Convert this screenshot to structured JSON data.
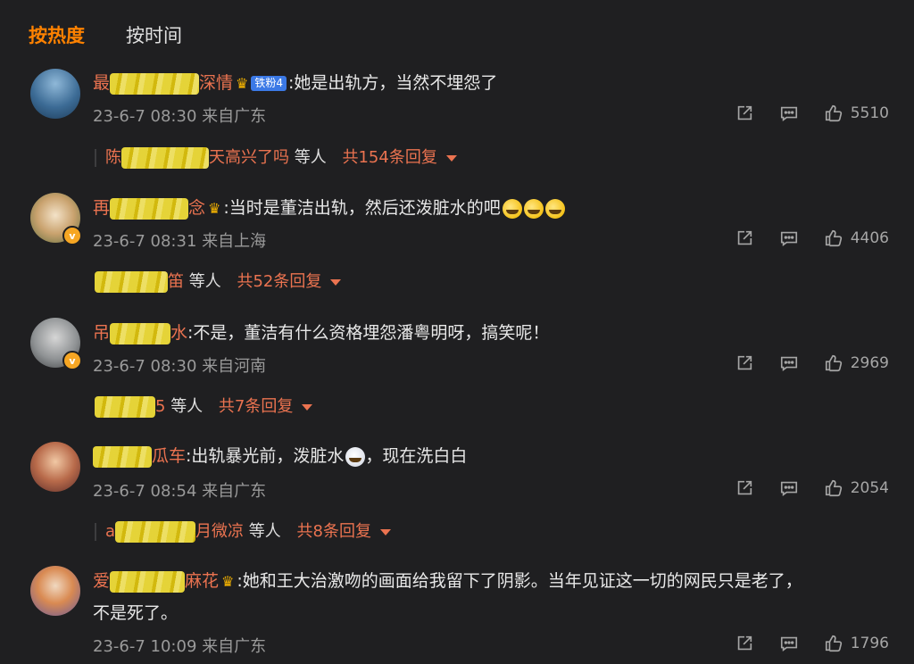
{
  "tabs": [
    "按热度",
    "按时间"
  ],
  "comments": [
    {
      "name_prefix": "最",
      "name_suffix": "深情",
      "fan_badge": "铁粉4",
      "text": ":她是出轨方，当然不埋怨了",
      "meta": "23-6-7 08:30 来自广东",
      "likes": "5510",
      "reply_prefix": "陈",
      "reply_suffix": "天高兴了吗",
      "reply_people": "等人",
      "reply_count": "共154条回复"
    },
    {
      "name_prefix": "再",
      "name_suffix": "念",
      "text": ":当时是董洁出轨，然后还泼脏水的吧",
      "meta": "23-6-7 08:31 来自上海",
      "likes": "4406",
      "reply_prefix": "",
      "reply_suffix": "笛",
      "reply_people": "等人",
      "reply_count": "共52条回复"
    },
    {
      "name_prefix": "吊",
      "name_suffix": "水",
      "text": ":不是，董洁有什么资格埋怨潘粤明呀，搞笑呢！",
      "meta": "23-6-7 08:30 来自河南",
      "likes": "2969",
      "reply_prefix": "",
      "reply_suffix": "5",
      "reply_people": "等人",
      "reply_count": "共7条回复"
    },
    {
      "name_prefix": "",
      "name_suffix": "瓜车",
      "text_a": ":出轨暴光前，泼脏水",
      "text_b": "，现在洗白白",
      "meta": "23-6-7 08:54 来自广东",
      "likes": "2054",
      "reply_prefix": "a",
      "reply_suffix": "月微凉",
      "reply_people": "等人",
      "reply_count": "共8条回复"
    },
    {
      "name_prefix": "爱",
      "name_suffix": "麻花",
      "text": ":她和王大治激吻的画面给我留下了阴影。当年见证这一切的网民只是老了，",
      "text2": "不是死了。",
      "meta": "23-6-7 10:09 来自广东",
      "likes": "1796"
    }
  ],
  "icons": {
    "share": "share-icon",
    "comment": "comment-icon",
    "like": "thumbs-up-icon"
  },
  "colors": {
    "accent": "#ff8200",
    "username": "#eb7350",
    "background": "#1f1f21"
  }
}
